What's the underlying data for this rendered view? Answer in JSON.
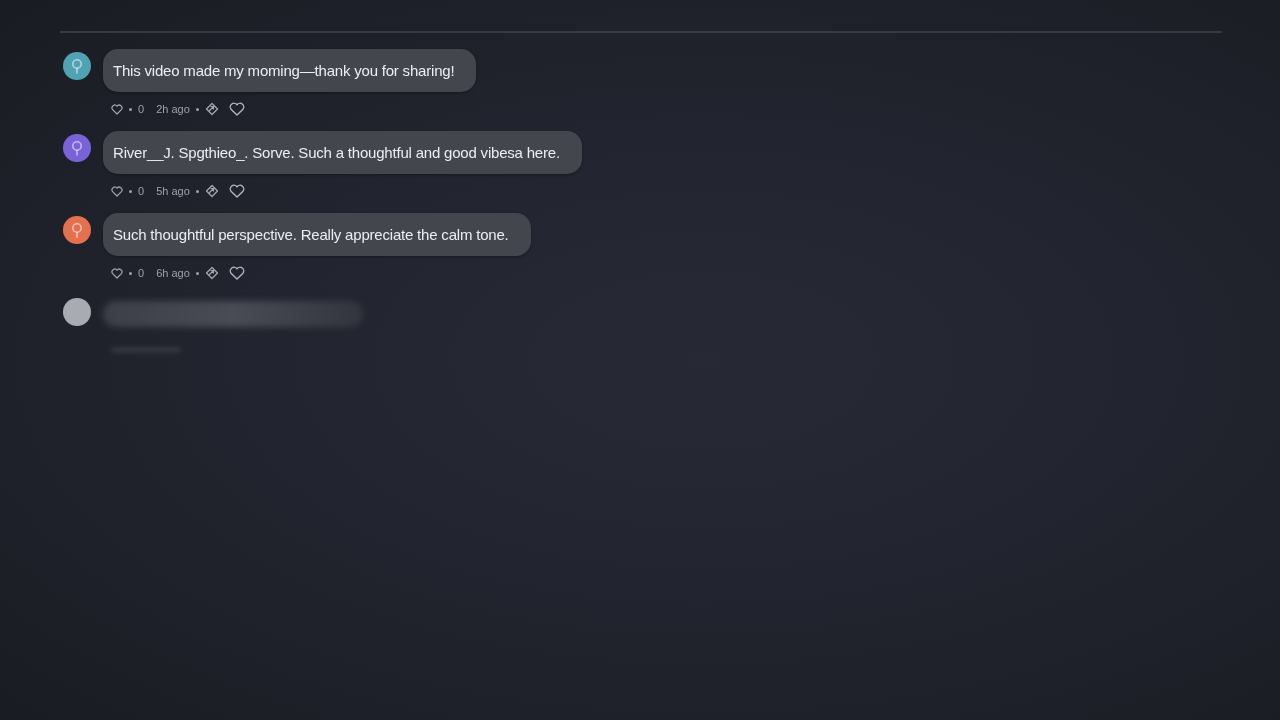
{
  "comments": [
    {
      "kind": "comment",
      "color": "#4fa3b3",
      "text": "This video made my moming—thank you for sharing!",
      "likes": "0",
      "time": "2h ago"
    },
    {
      "kind": "comment",
      "color": "#7a63d8",
      "text": "River__J. Spgthieo_. Sorve. Such a thoughtful and good vibesa here.",
      "likes": "0",
      "time": "5h ago"
    },
    {
      "kind": "comment",
      "color": "#e5704e",
      "text": "Such thoughtful perspective. Really appreciate the calm tone.",
      "likes": "0",
      "time": "6h ago"
    },
    {
      "kind": "blurred",
      "color": "#a9abb2"
    }
  ]
}
